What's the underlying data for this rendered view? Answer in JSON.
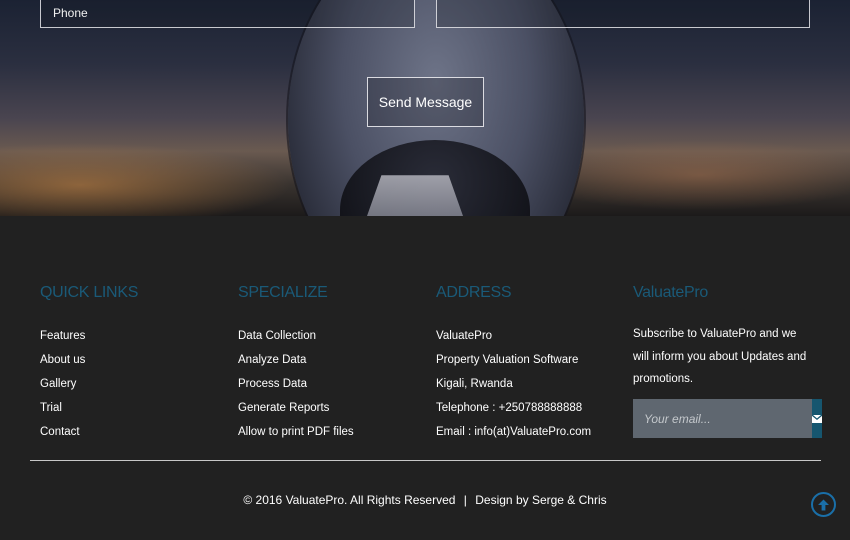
{
  "contact_form": {
    "phone_placeholder": "Phone",
    "other_placeholder": "",
    "send_label": "Send Message"
  },
  "footer": {
    "quick_links": {
      "title": "QUICK LINKS",
      "items": [
        "Features",
        "About us",
        "Gallery",
        "Trial",
        "Contact"
      ]
    },
    "specialize": {
      "title": "SPECIALIZE",
      "items": [
        "Data Collection",
        "Analyze Data",
        "Process Data",
        "Generate Reports",
        "Allow to print PDF files"
      ]
    },
    "address": {
      "title": "ADDRESS",
      "lines": [
        "ValuatePro",
        "Property Valuation Software",
        "Kigali, Rwanda",
        "Telephone : +250788888888",
        "Email : info(at)ValuatePro.com"
      ]
    },
    "newsletter": {
      "title": "ValuatePro",
      "text": "Subscribe to ValuatePro and we will inform you about Updates and promotions.",
      "email_placeholder": "Your email..."
    },
    "copyright": {
      "text": "© 2016 ValuatePro. All Rights Reserved",
      "separator": "|",
      "credit": "Design by Serge & Chris"
    }
  },
  "icons": {
    "subscribe": "envelope-icon",
    "back_to_top": "arrow-up-circle-icon"
  },
  "colors": {
    "footer_bg": "#212121",
    "heading": "#1a5a78",
    "subscribe_button": "#16566f",
    "email_field": "#5f6770",
    "back_to_top": "#1a6fa8"
  }
}
